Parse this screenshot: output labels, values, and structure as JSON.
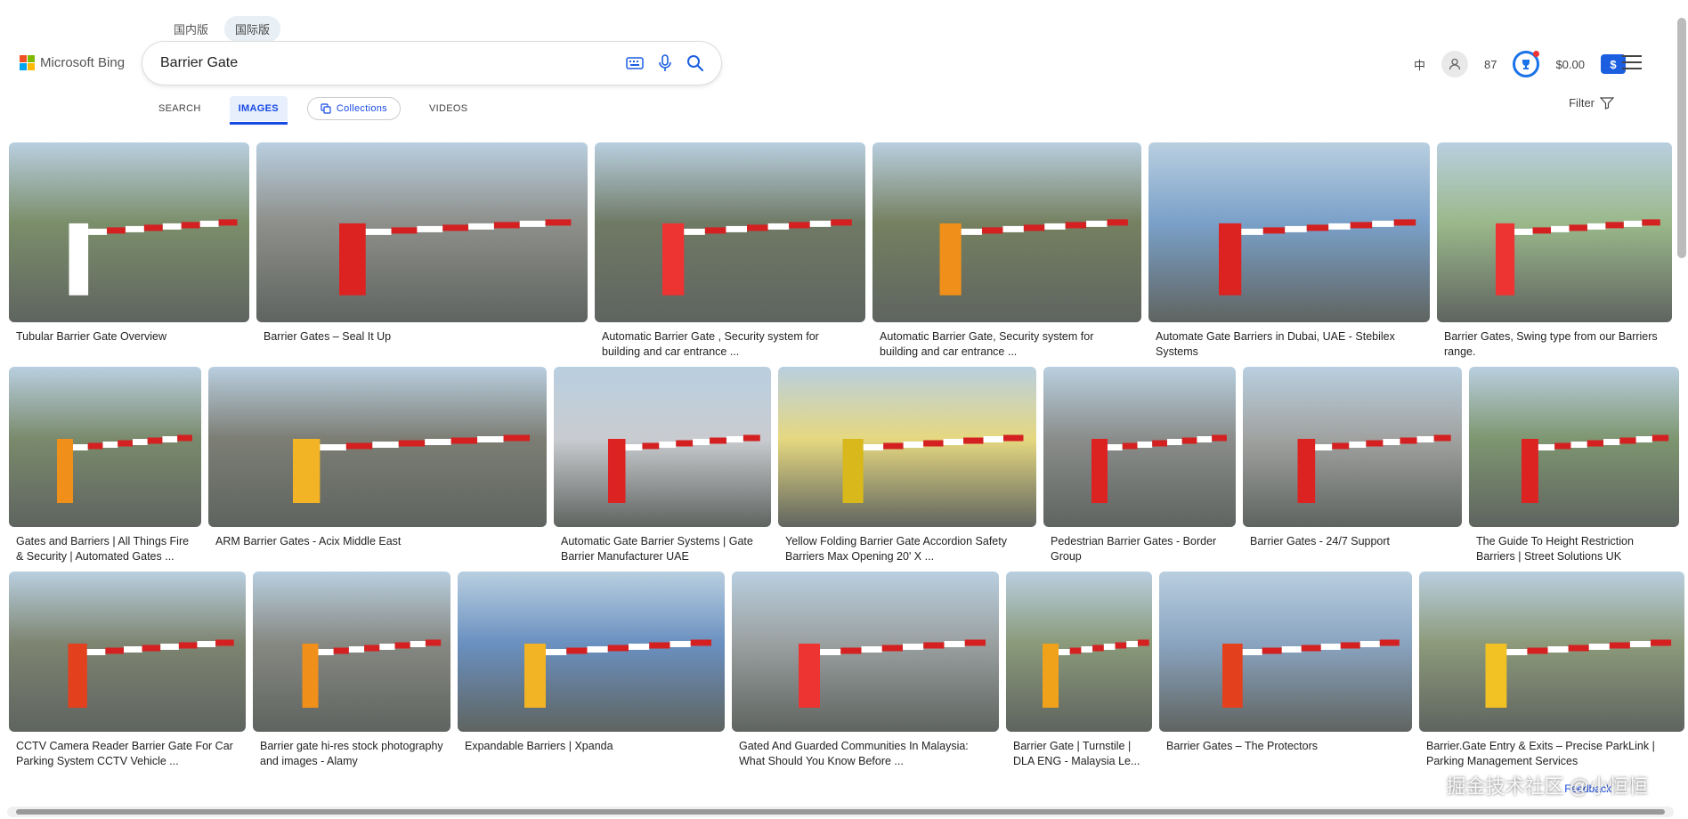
{
  "region_tabs": [
    {
      "label": "国内版",
      "active": false
    },
    {
      "label": "国际版",
      "active": true
    }
  ],
  "logo": {
    "text": "Microsoft Bing"
  },
  "search": {
    "query": "Barrier Gate"
  },
  "header": {
    "lang_icon": "中",
    "points": "87",
    "balance": "$0.00",
    "dollar_symbol": "$"
  },
  "nav": {
    "search": "SEARCH",
    "images": "IMAGES",
    "collections": "Collections",
    "videos": "VIDEOS"
  },
  "filter": {
    "label": "Filter"
  },
  "rows": [
    [
      {
        "caption": "Tubular Barrier Gate Overview",
        "w": 270,
        "h": 202,
        "bg": "#7b8e6a",
        "accent": "#ffffff"
      },
      {
        "caption": "Barrier Gates – Seal It Up",
        "w": 372,
        "h": 202,
        "bg": "#8d8f8a",
        "accent": "#d22"
      },
      {
        "caption": "Automatic Barrier Gate , Security system for building and car entrance ...",
        "w": 304,
        "h": 202,
        "bg": "#6f7a65",
        "accent": "#e33"
      },
      {
        "caption": "Automatic Barrier Gate, Security system for building and car entrance ...",
        "w": 302,
        "h": 202,
        "bg": "#758060",
        "accent": "#f0901a"
      },
      {
        "caption": "Automate Gate Barriers in Dubai, UAE - Stebilex Systems",
        "w": 316,
        "h": 202,
        "bg": "#7aa0c8",
        "accent": "#d22"
      },
      {
        "caption": "Barrier Gates, Swing type from our Barriers range.",
        "w": 264,
        "h": 202,
        "bg": "#9ab88a",
        "accent": "#e33"
      }
    ],
    [
      {
        "caption": "Gates and Barriers | All Things Fire & Security | Automated Gates ...",
        "w": 216,
        "h": 180,
        "bg": "#7a8a6c",
        "accent": "#f0901a"
      },
      {
        "caption": "ARM Barrier Gates - Acix Middle East",
        "w": 380,
        "h": 180,
        "bg": "#7c7e74",
        "accent": "#f2b324"
      },
      {
        "caption": "Automatic Gate Barrier Systems | Gate Barrier Manufacturer UAE",
        "w": 244,
        "h": 180,
        "bg": "#c9ccd0",
        "accent": "#d22"
      },
      {
        "caption": "Yellow Folding Barrier Gate Accordion Safety Barriers Max Opening 20' X ...",
        "w": 290,
        "h": 180,
        "bg": "#e6d880",
        "accent": "#d8b81a"
      },
      {
        "caption": "Pedestrian Barrier Gates - Border Group",
        "w": 216,
        "h": 180,
        "bg": "#8a8d8a",
        "accent": "#d22"
      },
      {
        "caption": "Barrier Gates - 24/7 Support",
        "w": 246,
        "h": 180,
        "bg": "#a0a2a0",
        "accent": "#d22"
      },
      {
        "caption": "The Guide To Height Restriction Barriers | Street Solutions UK",
        "w": 236,
        "h": 180,
        "bg": "#7e9670",
        "accent": "#d22"
      }
    ],
    [
      {
        "caption": "CCTV Camera Reader Barrier Gate For Car Parking System CCTV Vehicle ...",
        "w": 266,
        "h": 180,
        "bg": "#7d8470",
        "accent": "#e3401e"
      },
      {
        "caption": "Barrier gate hi-res stock photography and images - Alamy",
        "w": 222,
        "h": 180,
        "bg": "#868882",
        "accent": "#f0901a"
      },
      {
        "caption": "Expandable Barriers | Xpanda",
        "w": 300,
        "h": 180,
        "bg": "#6a90c0",
        "accent": "#f2b324"
      },
      {
        "caption": "Gated And Guarded Communities In Malaysia: What Should You Know Before ...",
        "w": 300,
        "h": 180,
        "bg": "#9aa0a0",
        "accent": "#e33"
      },
      {
        "caption": "Barrier Gate | Turnstile | DLA ENG - Malaysia Le...",
        "w": 164,
        "h": 180,
        "bg": "#8a9a7a",
        "accent": "#f0a21a"
      },
      {
        "caption": "Barrier Gates – The Protectors",
        "w": 284,
        "h": 180,
        "bg": "#8aa4c0",
        "accent": "#e3401e"
      },
      {
        "caption": "Barrier.Gate Entry & Exits – Precise ParkLink | Parking Management Services",
        "w": 298,
        "h": 180,
        "bg": "#8c9a7a",
        "accent": "#f2c224"
      }
    ]
  ],
  "watermark": "掘金技术社区 @小恒恒",
  "feedback": "Feedback"
}
